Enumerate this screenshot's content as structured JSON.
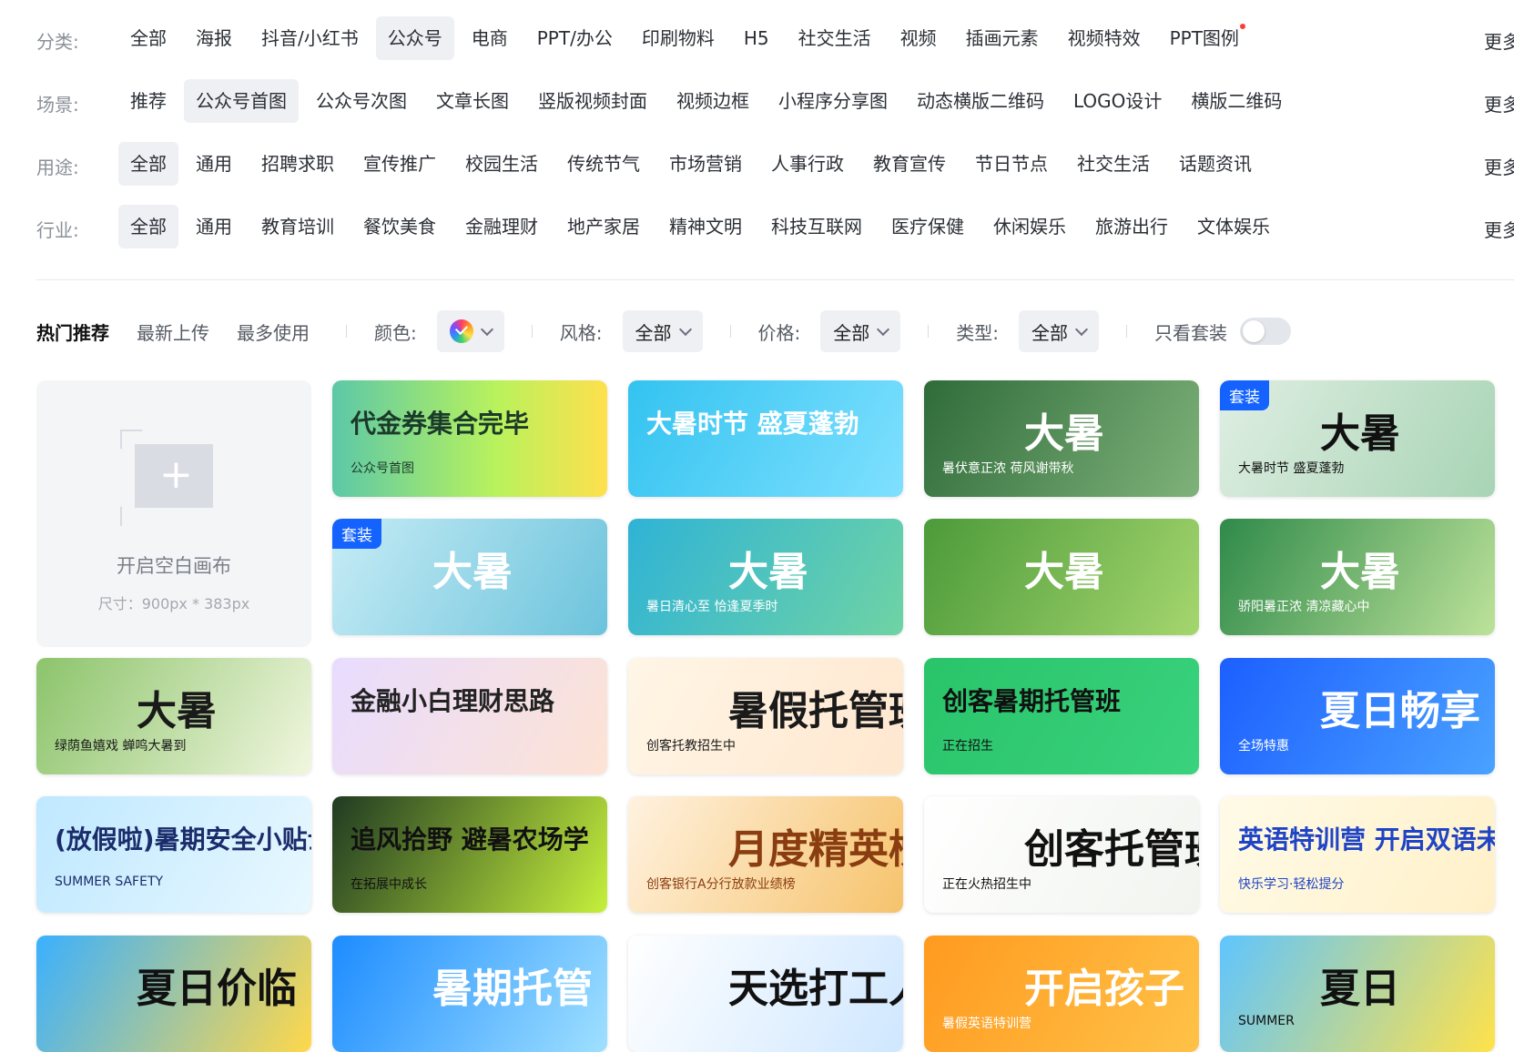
{
  "filters": [
    {
      "label": "分类:",
      "items": [
        "全部",
        "海报",
        "抖音/小红书",
        "公众号",
        "电商",
        "PPT/办公",
        "印刷物料",
        "H5",
        "社交生活",
        "视频",
        "插画元素",
        "视频特效",
        "PPT图例"
      ],
      "active": 3,
      "more": "更多"
    },
    {
      "label": "场景:",
      "items": [
        "推荐",
        "公众号首图",
        "公众号次图",
        "文章长图",
        "竖版视频封面",
        "视频边框",
        "小程序分享图",
        "动态横版二维码",
        "LOGO设计",
        "横版二维码"
      ],
      "active": 1,
      "more": "更多"
    },
    {
      "label": "用途:",
      "items": [
        "全部",
        "通用",
        "招聘求职",
        "宣传推广",
        "校园生活",
        "传统节气",
        "市场营销",
        "人事行政",
        "教育宣传",
        "节日节点",
        "社交生活",
        "话题资讯"
      ],
      "active": 0,
      "more": "更多"
    },
    {
      "label": "行业:",
      "items": [
        "全部",
        "通用",
        "教育培训",
        "餐饮美食",
        "金融理财",
        "地产家居",
        "精神文明",
        "科技互联网",
        "医疗保健",
        "休闲娱乐",
        "旅游出行",
        "文体娱乐"
      ],
      "active": 0,
      "more": "更多"
    }
  ],
  "sortbar": {
    "sorts": [
      "热门推荐",
      "最新上传",
      "最多使用"
    ],
    "color_label": "颜色:",
    "style_label": "风格:",
    "style_value": "全部",
    "price_label": "价格:",
    "price_value": "全部",
    "type_label": "类型:",
    "type_value": "全部",
    "set_only_label": "只看套装",
    "set_only_on": false
  },
  "blank_canvas": {
    "label": "开启空白画布",
    "size": "尺寸：900px * 383px"
  },
  "badge_text": "套装",
  "cards": [
    {
      "row": 0,
      "col": 1,
      "title": "代金券集合完毕",
      "sub": "公众号首图",
      "bg": "linear-gradient(90deg,#5cc8a8,#b9f25c 60%,#ffe04d)",
      "color": "#1a3a2a"
    },
    {
      "row": 0,
      "col": 2,
      "title": "大暑时节 盛夏蓬勃",
      "sub": "",
      "bg": "linear-gradient(120deg,#33c3f0,#7fe0ff)",
      "color": "#ffffff"
    },
    {
      "row": 0,
      "col": 3,
      "title": "大暑",
      "sub": "暑伏意正浓 荷风谢带秋",
      "bg": "linear-gradient(120deg,#2f6b3a,#7fb27a)",
      "color": "#ffffff"
    },
    {
      "row": 0,
      "col": 4,
      "title": "大暑",
      "sub": "大暑时节 盛夏蓬勃",
      "bg": "linear-gradient(120deg,#dfeee3,#a8d4b4)",
      "color": "#111111",
      "badge": true
    },
    {
      "row": 1,
      "col": 1,
      "title": "大暑",
      "sub": "",
      "bg": "linear-gradient(120deg,#c6ecf5,#6cc3dc)",
      "color": "#ffffff",
      "badge": true
    },
    {
      "row": 1,
      "col": 2,
      "title": "大暑",
      "sub": "暑日清心至 恰逢夏季时",
      "bg": "linear-gradient(120deg,#2fb3d6,#6fd3a4)",
      "color": "#ffffff"
    },
    {
      "row": 1,
      "col": 3,
      "title": "大暑",
      "sub": "",
      "bg": "linear-gradient(120deg,#4c9a3a,#a5d66e)",
      "color": "#ffffff"
    },
    {
      "row": 1,
      "col": 4,
      "title": "大暑",
      "sub": "骄阳暑正浓 清凉藏心中",
      "bg": "linear-gradient(120deg,#2f8a4a,#bde29a)",
      "color": "#ffffff"
    },
    {
      "row": 2,
      "col": 0,
      "title": "大暑",
      "sub": "绿荫鱼嬉戏 蝉鸣大暑到",
      "bg": "linear-gradient(120deg,#8cc46b,#f1f6df)",
      "color": "#1a1a1a"
    },
    {
      "row": 2,
      "col": 1,
      "title": "金融小白理财思路",
      "sub": "",
      "bg": "linear-gradient(120deg,#e8dcff,#fde3d4)",
      "color": "#222222"
    },
    {
      "row": 2,
      "col": 2,
      "title": "暑假托管班",
      "sub": "创客托教招生中",
      "bg": "linear-gradient(120deg,#fff6e6,#ffe7cf)",
      "color": "#1a1a1a"
    },
    {
      "row": 2,
      "col": 3,
      "title": "创客暑期托管班",
      "sub": "正在招生",
      "bg": "linear-gradient(120deg,#29c46a,#3ad27d)",
      "color": "#111111"
    },
    {
      "row": 2,
      "col": 4,
      "title": "夏日畅享",
      "sub": "全场特惠",
      "bg": "linear-gradient(120deg,#1c5fff,#4aa2ff)",
      "color": "#ffffff"
    },
    {
      "row": 3,
      "col": 0,
      "title": "(放假啦)暑期安全小贴士",
      "sub": "SUMMER SAFETY",
      "bg": "linear-gradient(120deg,#bfe8ff,#e8f8ff)",
      "color": "#1b2c6b"
    },
    {
      "row": 3,
      "col": 1,
      "title": "追风拾野 避暑农场学",
      "sub": "在拓展中成长",
      "bg": "linear-gradient(120deg,#1f3a22,#c6f03c)",
      "color": "#111111"
    },
    {
      "row": 3,
      "col": 2,
      "title": "月度精英榜",
      "sub": "创客银行A分行放款业绩榜",
      "bg": "linear-gradient(120deg,#fff2e0,#f6c36c)",
      "color": "#8a3d10"
    },
    {
      "row": 3,
      "col": 3,
      "title": "创客托管班",
      "sub": "正在火热招生中",
      "bg": "linear-gradient(120deg,#ffffff,#f1f4ef)",
      "color": "#111111"
    },
    {
      "row": 3,
      "col": 4,
      "title": "英语特训营 开启双语未来",
      "sub": "快乐学习·轻松提分",
      "bg": "linear-gradient(120deg,#fffbe8,#fff0c8)",
      "color": "#1f44c6"
    },
    {
      "row": 4,
      "col": 0,
      "title": "夏日价临",
      "sub": "",
      "bg": "linear-gradient(120deg,#3ab0ff,#ffd84a)",
      "color": "#111111"
    },
    {
      "row": 4,
      "col": 1,
      "title": "暑期托管",
      "sub": "",
      "bg": "linear-gradient(120deg,#1d8cff,#9fe0ff)",
      "color": "#ffffff"
    },
    {
      "row": 4,
      "col": 2,
      "title": "天选打工人",
      "sub": "",
      "bg": "linear-gradient(120deg,#ffffff,#cfe7ff)",
      "color": "#111111"
    },
    {
      "row": 4,
      "col": 3,
      "title": "开启孩子",
      "sub": "暑假英语特训营",
      "bg": "linear-gradient(120deg,#ff9a1f,#ffc248)",
      "color": "#ffffff"
    },
    {
      "row": 4,
      "col": 4,
      "title": "夏日",
      "sub": "SUMMER",
      "bg": "linear-gradient(120deg,#5fc5ff,#ffe24a)",
      "color": "#111111"
    }
  ]
}
